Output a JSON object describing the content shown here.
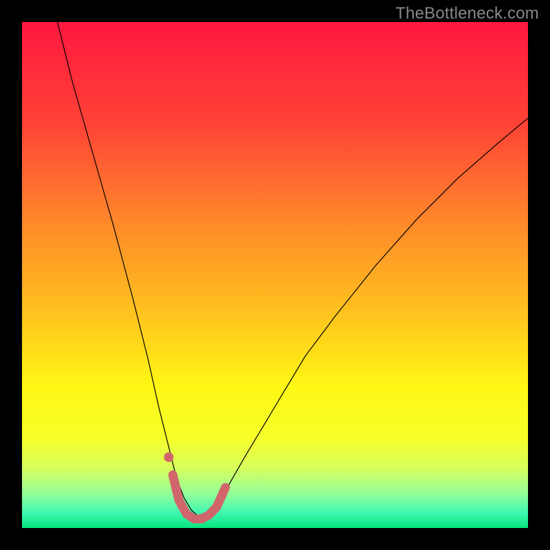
{
  "watermark": {
    "text": "TheBottleneck.com"
  },
  "chart_data": {
    "type": "line",
    "title": "",
    "xlabel": "",
    "ylabel": "",
    "xlim": [
      0,
      100
    ],
    "ylim": [
      0,
      100
    ],
    "grid": false,
    "legend": false,
    "annotations": [],
    "background": {
      "type": "vertical-gradient",
      "stops": [
        {
          "pos": 0.0,
          "color": "#ff183f"
        },
        {
          "pos": 0.2,
          "color": "#ff4236"
        },
        {
          "pos": 0.4,
          "color": "#ff8a2a"
        },
        {
          "pos": 0.58,
          "color": "#ffc41e"
        },
        {
          "pos": 0.72,
          "color": "#fff714"
        },
        {
          "pos": 0.82,
          "color": "#f6ff28"
        },
        {
          "pos": 0.88,
          "color": "#d8ff5a"
        },
        {
          "pos": 0.93,
          "color": "#98ff98"
        },
        {
          "pos": 0.97,
          "color": "#40f7b0"
        },
        {
          "pos": 1.0,
          "color": "#06e57e"
        }
      ]
    },
    "series": [
      {
        "name": "bottleneck-curve",
        "type": "line",
        "color": "#000000",
        "width": 1.2,
        "x": [
          7,
          10,
          14,
          18,
          22,
          25,
          27,
          29,
          30.5,
          32,
          33.5,
          35,
          37,
          40,
          44,
          50,
          56,
          62,
          70,
          78,
          86,
          94,
          100
        ],
        "values": [
          100,
          88,
          74,
          60,
          45,
          33,
          24,
          16,
          10,
          6,
          3.5,
          2.2,
          3.5,
          7,
          14,
          24,
          34,
          42,
          52,
          61,
          69,
          76,
          81
        ]
      },
      {
        "name": "optimal-marker",
        "type": "line",
        "color": "#d1656c",
        "cap": "round",
        "width": 13,
        "x": [
          29.8,
          31,
          32.5,
          34,
          35.5,
          37,
          38.5,
          40.2
        ],
        "values": [
          10.5,
          5.5,
          2.8,
          1.8,
          1.8,
          2.6,
          4.2,
          8.0
        ]
      },
      {
        "name": "optimal-marker-dot",
        "type": "scatter",
        "color": "#d1656c",
        "radius": 7,
        "x": [
          29.0
        ],
        "values": [
          14.0
        ]
      }
    ]
  }
}
